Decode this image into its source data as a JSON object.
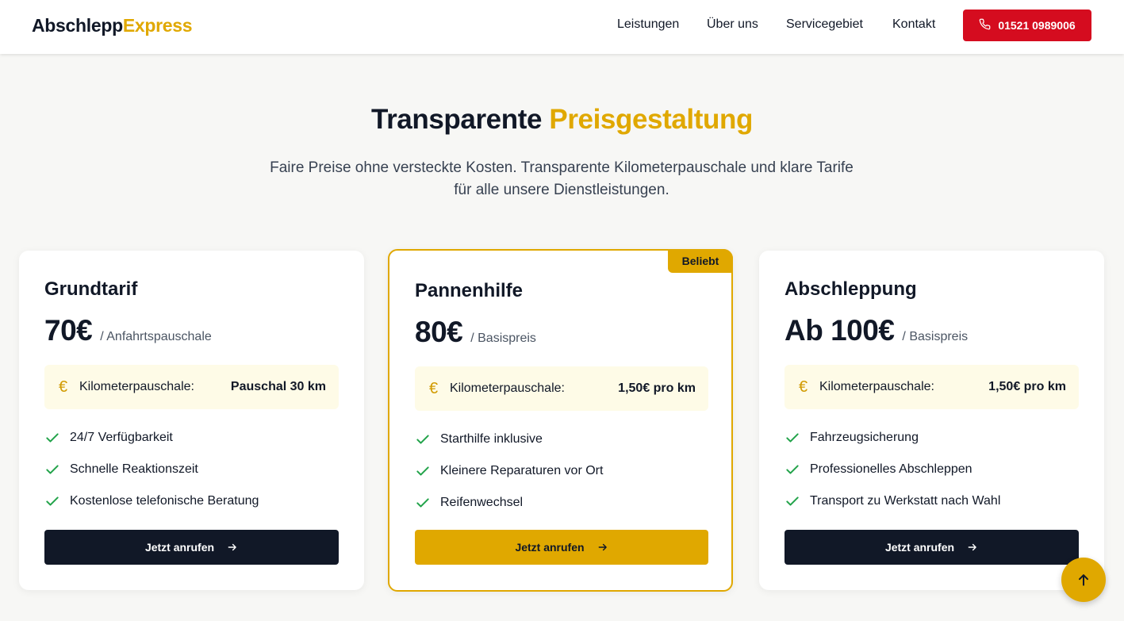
{
  "header": {
    "logo_part1": "Abschlepp",
    "logo_part2": "Express",
    "nav": [
      "Leistungen",
      "Über uns",
      "Servicegebiet",
      "Kontakt"
    ],
    "phone": "01521 0989006",
    "phone_icon": "phone-icon"
  },
  "section": {
    "title_part1": "Transparente",
    "title_part2": "Preisgestaltung",
    "subtitle_line1": "Faire Preise ohne versteckte Kosten. Transparente Kilometerpauschale und klare Tarife",
    "subtitle_line2": "für alle unsere Dienstleistungen."
  },
  "cards": [
    {
      "title": "Grundtarif",
      "price": "70€",
      "unit": "/ Anfahrtspauschale",
      "km_label": "Kilometerpauschale:",
      "km_value": "Pauschal 30 km",
      "features": [
        "24/7 Verfügbarkeit",
        "Schnelle Reaktionszeit",
        "Kostenlose telefonische Beratung"
      ],
      "cta": "Jetzt anrufen"
    },
    {
      "title": "Pannenhilfe",
      "badge": "Beliebt",
      "price": "80€",
      "unit": "/ Basispreis",
      "km_label": "Kilometerpauschale:",
      "km_value": "1,50€ pro km",
      "features": [
        "Starthilfe inklusive",
        "Kleinere Reparaturen vor Ort",
        "Reifenwechsel"
      ],
      "cta": "Jetzt anrufen"
    },
    {
      "title": "Abschleppung",
      "price": "Ab 100€",
      "unit": "/ Basispreis",
      "km_label": "Kilometerpauschale:",
      "km_value": "1,50€ pro km",
      "features": [
        "Fahrzeugsicherung",
        "Professionelles Abschleppen",
        "Transport zu Werkstatt nach Wahl"
      ],
      "cta": "Jetzt anrufen"
    }
  ],
  "colors": {
    "accent": "#e0a800",
    "call_button": "#d50c1f",
    "dark_button": "#111827",
    "km_box": "#fefbe7",
    "check": "#22a34a"
  },
  "icons": {
    "euro": "euro-icon",
    "check": "check-icon",
    "arrow": "arrow-right-icon",
    "scroll_top": "arrow-up-icon"
  }
}
